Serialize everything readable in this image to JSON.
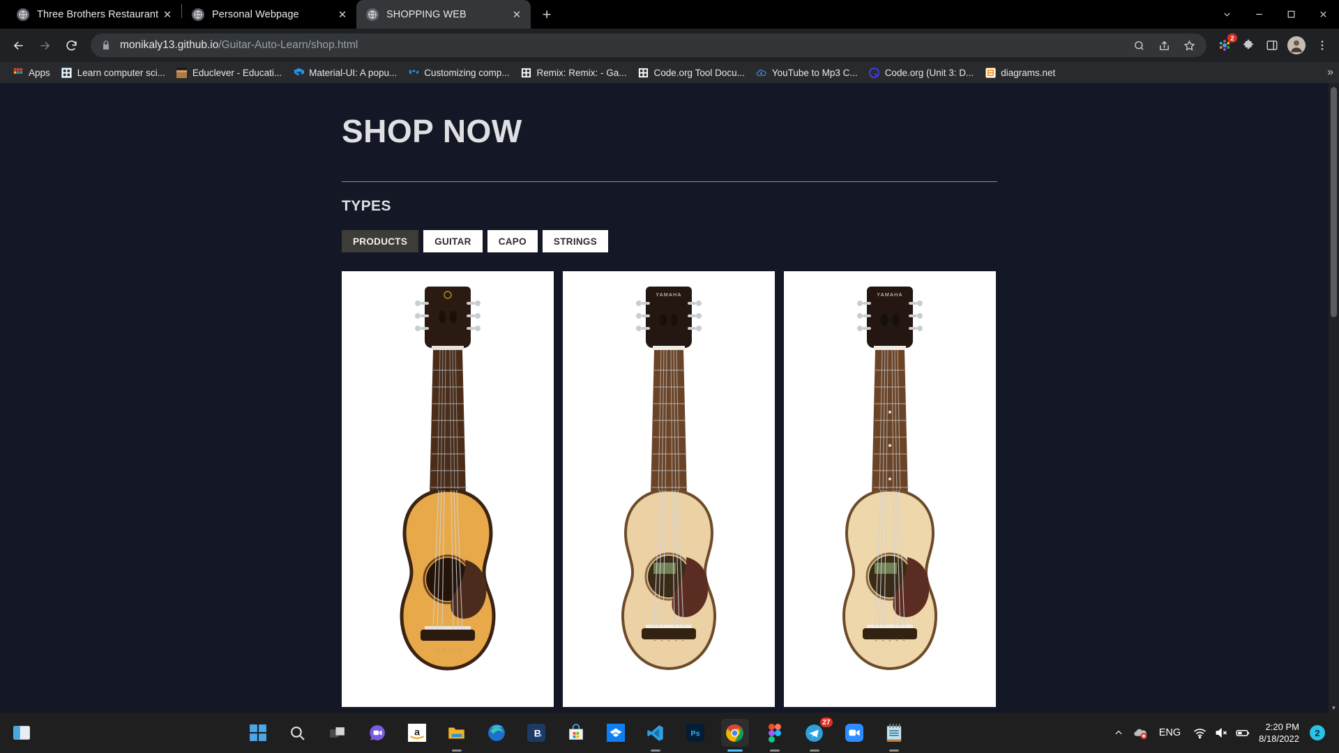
{
  "browser": {
    "tabs": [
      {
        "title": "Three Brothers Restaurant",
        "favicon": "globe-icon",
        "active": false,
        "close": "✕"
      },
      {
        "title": "Personal Webpage",
        "favicon": "globe-icon",
        "active": false,
        "close": "✕"
      },
      {
        "title": "SHOPPING WEB",
        "favicon": "globe-icon",
        "active": true,
        "close": "✕"
      }
    ],
    "new_tab_label": "+",
    "window_controls": {
      "minimize": "minimize-icon",
      "maximize": "maximize-icon",
      "close": "close-icon",
      "dropdown": "chevron-down-icon"
    },
    "nav": {
      "back": "back-arrow-icon",
      "forward": "forward-arrow-icon",
      "reload": "reload-icon"
    },
    "omnibox": {
      "lock": "lock-icon",
      "url_domain": "monikaly13.github.io",
      "url_path": "/Guitar-Auto-Learn/shop.html",
      "search_icon": "search-icon",
      "share_icon": "share-icon",
      "bookmark_icon": "star-icon"
    },
    "toolbar_icons": [
      {
        "name": "extension-puzzle-colored-icon",
        "badge": "2"
      },
      {
        "name": "extensions-icon",
        "badge": ""
      },
      {
        "name": "sidepanel-icon",
        "badge": ""
      },
      {
        "name": "profile-avatar",
        "badge": ""
      },
      {
        "name": "more-vertical-icon",
        "badge": ""
      }
    ],
    "bookmarks": [
      {
        "label": "Apps",
        "icon": "apps-grid-icon"
      },
      {
        "label": "Learn computer sci...",
        "icon": "blue-grid-icon"
      },
      {
        "label": "Educlever - Educati...",
        "icon": "thumbnail-icon"
      },
      {
        "label": "Material-UI: A popu...",
        "icon": "mui-icon"
      },
      {
        "label": "Customizing comp...",
        "icon": "mui-icon"
      },
      {
        "label": "Remix: Remix: - Ga...",
        "icon": "grid-icon"
      },
      {
        "label": "Code.org Tool Docu...",
        "icon": "grid-icon"
      },
      {
        "label": "YouTube to Mp3 C...",
        "icon": "cloud-download-icon"
      },
      {
        "label": "Code.org (Unit 3: D...",
        "icon": "q-circle-icon"
      },
      {
        "label": "diagrams.net",
        "icon": "diagrams-icon"
      }
    ],
    "bookmarks_overflow": "»"
  },
  "page": {
    "title": "SHOP NOW",
    "section_label": "TYPES",
    "filters": [
      {
        "label": "PRODUCTS",
        "active": true
      },
      {
        "label": "GUITAR",
        "active": false
      },
      {
        "label": "CAPO",
        "active": false
      },
      {
        "label": "STRINGS",
        "active": false
      }
    ],
    "products": [
      {
        "name": "acoustic-guitar-amber",
        "brand": "YAMAHA",
        "body_color": "#d9912f",
        "top_color": "#e8a94a",
        "soundhole_ring": "#3a2416",
        "pickguard": "#4a2b1c"
      },
      {
        "name": "acoustic-guitar-natural-1",
        "brand": "YAMAHA",
        "body_color": "#e3c08c",
        "top_color": "#ecd1a4",
        "soundhole_ring": "#8a6a45",
        "pickguard": "#5b2d22"
      },
      {
        "name": "acoustic-guitar-natural-2",
        "brand": "YAMAHA",
        "body_color": "#e6c794",
        "top_color": "#efd7ac",
        "soundhole_ring": "#8a6a45",
        "pickguard": "#5b2d22"
      }
    ],
    "colors": {
      "background": "#141725",
      "heading": "#dfe0e4",
      "active_filter_bg": "#3c3c38",
      "filter_bg": "#ffffff"
    }
  },
  "taskbar": {
    "start": "windows-start-icon",
    "apps": [
      {
        "name": "search-icon",
        "state": ""
      },
      {
        "name": "task-view-icon",
        "state": ""
      },
      {
        "name": "chat-video-icon",
        "state": ""
      },
      {
        "name": "amazon-icon",
        "state": ""
      },
      {
        "name": "file-explorer-icon",
        "state": "open"
      },
      {
        "name": "microsoft-edge-icon",
        "state": ""
      },
      {
        "name": "brave-icon",
        "state": ""
      },
      {
        "name": "microsoft-store-icon",
        "state": ""
      },
      {
        "name": "dropbox-icon",
        "state": ""
      },
      {
        "name": "vs-code-icon",
        "state": "open"
      },
      {
        "name": "photoshop-icon",
        "state": ""
      },
      {
        "name": "google-chrome-icon",
        "state": "active"
      },
      {
        "name": "figma-icon",
        "state": "open"
      },
      {
        "name": "telegram-icon",
        "state": "open",
        "badge": "27"
      },
      {
        "name": "zoom-icon",
        "state": ""
      },
      {
        "name": "sticky-notes-icon",
        "state": "open"
      }
    ],
    "tray": {
      "chevron": "chevron-up-icon",
      "onedrive": "onedrive-error-icon",
      "language": "ENG",
      "wifi": "wifi-icon",
      "volume": "volume-muted-icon",
      "battery": "battery-icon",
      "time": "2:20 PM",
      "date": "8/18/2022",
      "notification_count": "2"
    }
  }
}
